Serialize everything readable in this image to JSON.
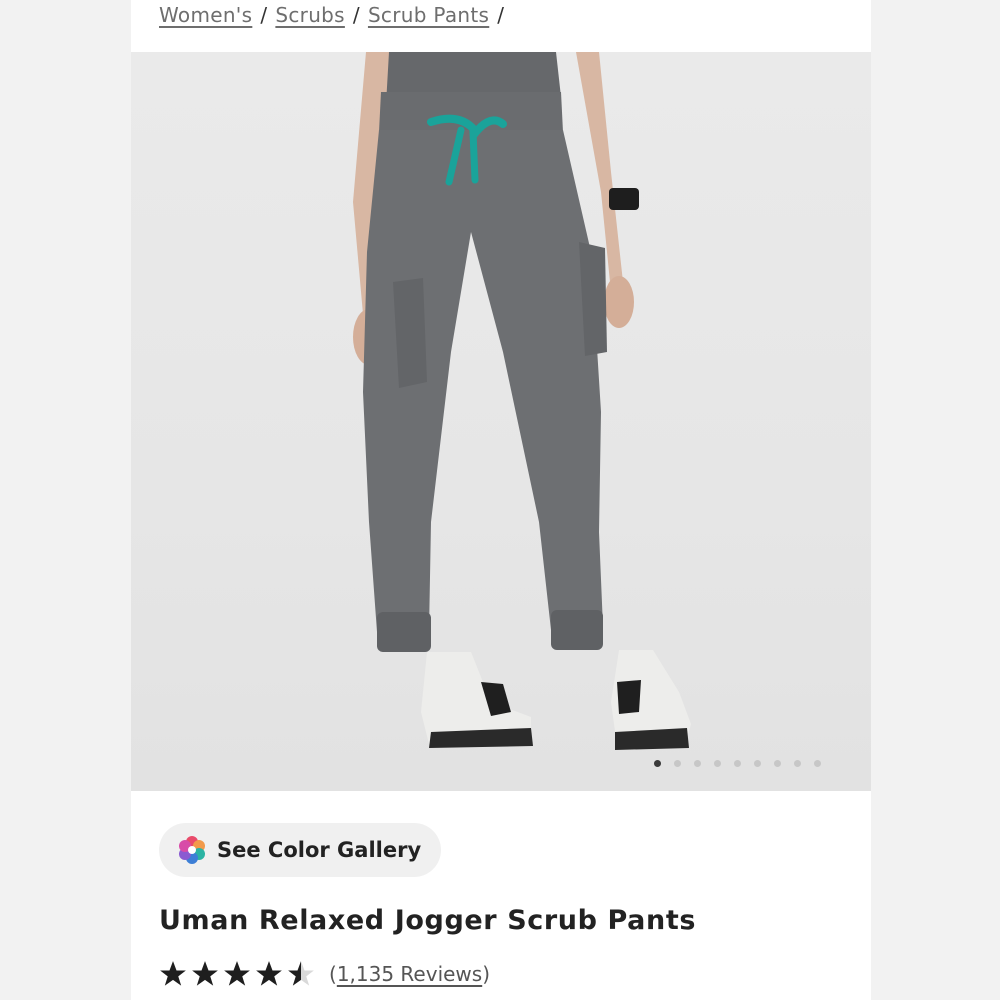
{
  "breadcrumb": {
    "items": [
      "Women's",
      "Scrubs",
      "Scrub Pants"
    ],
    "separator": "/"
  },
  "product_image": {
    "carousel": {
      "total_slides": 9,
      "active_index": 0
    }
  },
  "gallery": {
    "label": "See Color Gallery",
    "icon": "color-wheel-icon"
  },
  "product": {
    "title": "Uman Relaxed Jogger Scrub Pants",
    "rating": 4.5,
    "review_count_text": "1,135 Reviews"
  },
  "colors": {
    "pants": "#6d6f72",
    "drawstring": "#1aa39a",
    "background": "#e8e8e8"
  }
}
